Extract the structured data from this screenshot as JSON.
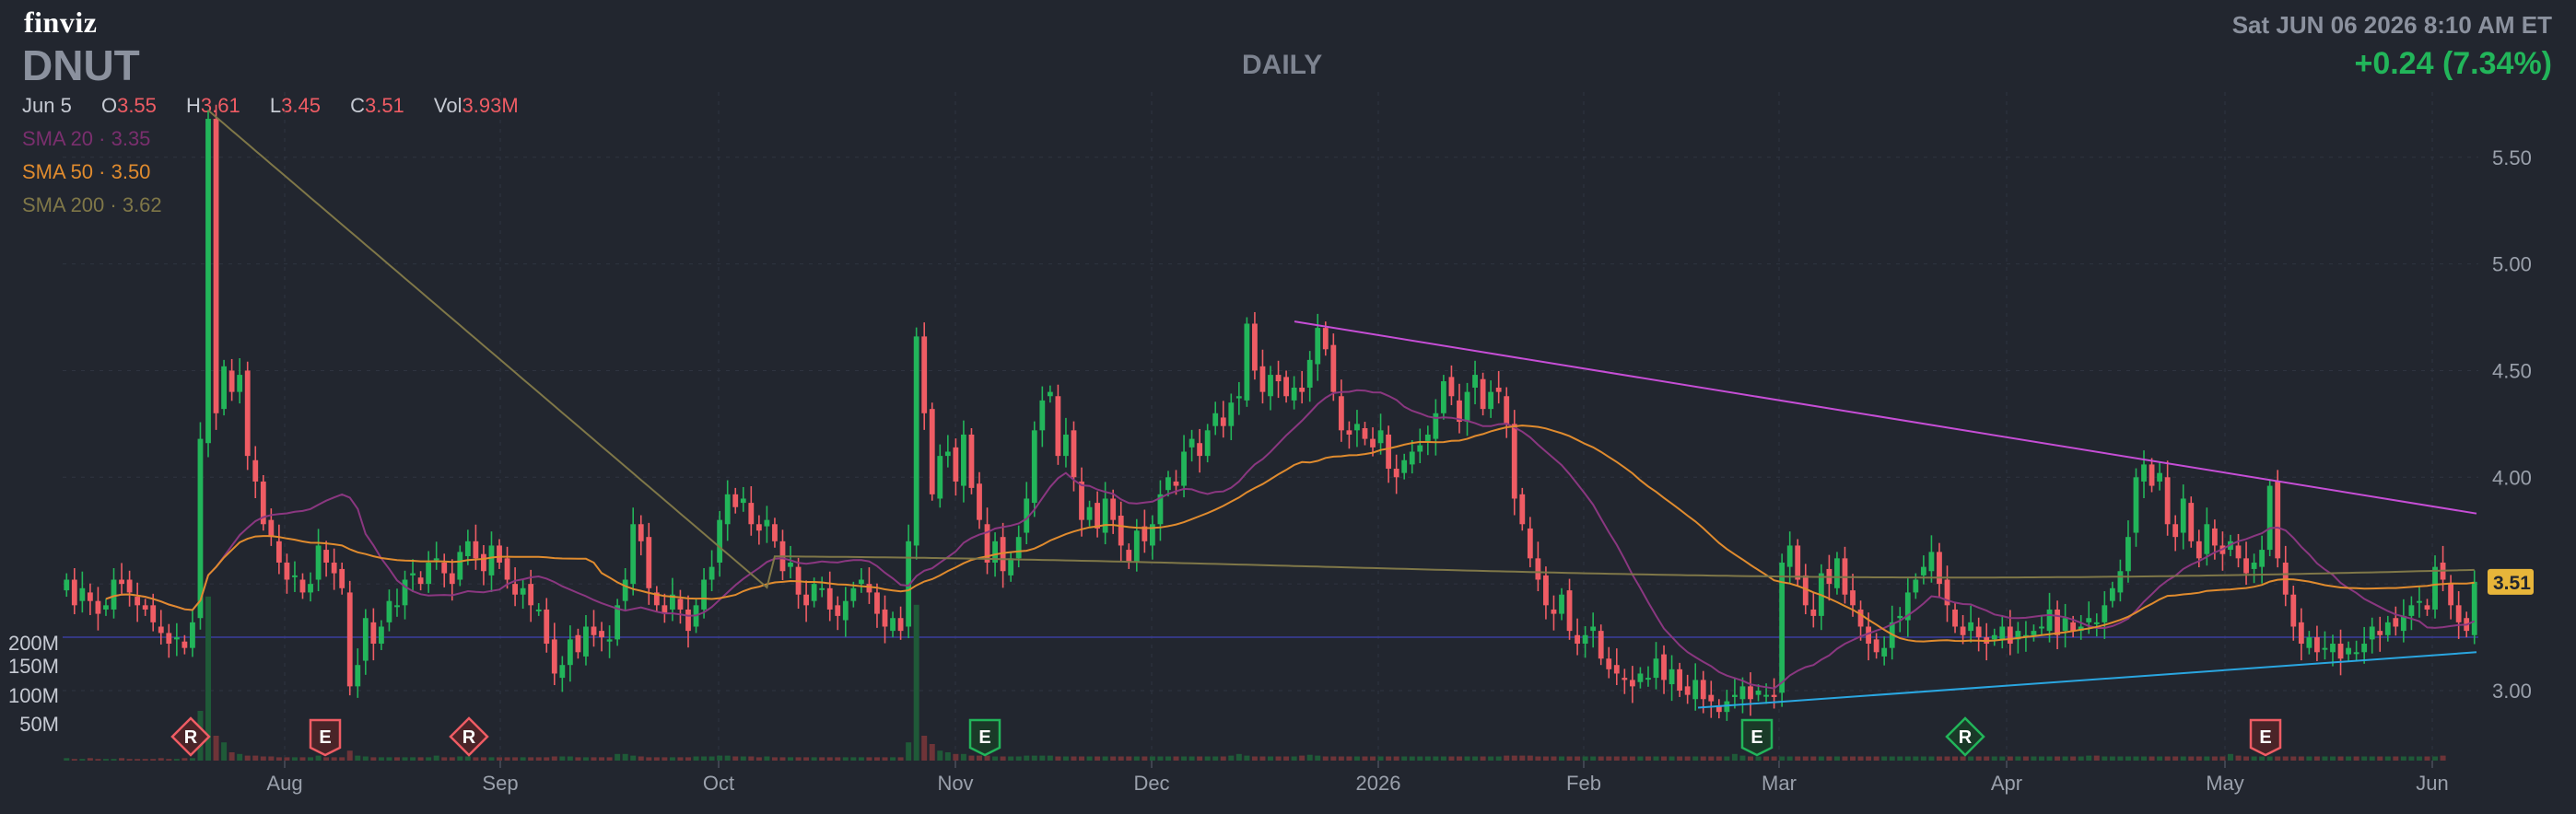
{
  "header": {
    "logo": "finviz",
    "ticker": "DNUT",
    "timeframe": "DAILY",
    "datetime": "Sat JUN 06 2026 8:10 AM ET",
    "change": "+0.24 (7.34%)"
  },
  "ohlc": {
    "date": "Jun 5",
    "o_label": "O",
    "o": "3.55",
    "h_label": "H",
    "h": "3.61",
    "l_label": "L",
    "l": "3.45",
    "c_label": "C",
    "c": "3.51",
    "vol_label": "Vol",
    "vol": "3.93M"
  },
  "sma": {
    "sma20": "SMA 20 · 3.35",
    "sma50": "SMA 50 · 3.50",
    "sma200": "SMA 200 · 3.62"
  },
  "colors": {
    "background": "#22262f",
    "up": "#22b55a",
    "down": "#ef5c64",
    "sma20": "#7a2f6e",
    "sma50": "#e08b2e",
    "sma200": "#7f7748",
    "resistance": "#c64ed6",
    "support": "#2aa6e0",
    "level": "#3b3f9e"
  },
  "chart_data": {
    "type": "candlestick",
    "title": "",
    "price_axis": {
      "ticks": [
        "3.00",
        "3.50",
        "4.00",
        "4.50",
        "5.00",
        "5.50"
      ],
      "ylim": [
        2.62,
        5.85
      ],
      "last_price": "3.51"
    },
    "volume_axis": {
      "ticks": [
        "50M",
        "100M",
        "150M",
        "200M"
      ]
    },
    "x_ticks": [
      "Aug",
      "Sep",
      "Oct",
      "Nov",
      "Dec",
      "2026",
      "Feb",
      "Mar",
      "Apr",
      "May",
      "Jun"
    ],
    "markers": [
      {
        "label": "R",
        "kind": "down",
        "date": "Jul 22"
      },
      {
        "label": "E",
        "kind": "down",
        "date": "Aug 5"
      },
      {
        "label": "R",
        "kind": "down",
        "date": "Aug 22"
      },
      {
        "label": "E",
        "kind": "up",
        "date": "Nov 6"
      },
      {
        "label": "E",
        "kind": "up",
        "date": "Feb 26"
      },
      {
        "label": "R",
        "kind": "up",
        "date": "Mar 30"
      },
      {
        "label": "E",
        "kind": "down",
        "date": "May 7"
      }
    ],
    "closes": [
      3.52,
      3.4,
      3.48,
      3.42,
      3.36,
      3.4,
      3.52,
      3.5,
      3.46,
      3.4,
      3.38,
      3.32,
      3.27,
      3.22,
      3.25,
      3.2,
      3.32,
      4.18,
      5.68,
      4.3,
      4.52,
      4.4,
      4.48,
      4.1,
      3.98,
      3.78,
      3.72,
      3.6,
      3.52,
      3.54,
      3.46,
      3.5,
      3.68,
      3.6,
      3.55,
      3.48,
      3.02,
      3.12,
      3.34,
      3.22,
      3.3,
      3.42,
      3.4,
      3.52,
      3.55,
      3.5,
      3.6,
      3.62,
      3.55,
      3.5,
      3.65,
      3.7,
      3.62,
      3.56,
      3.68,
      3.6,
      3.52,
      3.45,
      3.48,
      3.4,
      3.38,
      3.22,
      3.08,
      3.12,
      3.24,
      3.18,
      3.3,
      3.26,
      3.25,
      3.24,
      3.4,
      3.52,
      3.78,
      3.7,
      3.48,
      3.4,
      3.36,
      3.45,
      3.38,
      3.28,
      3.4,
      3.52,
      3.58,
      3.8,
      3.92,
      3.86,
      3.9,
      3.78,
      3.75,
      3.8,
      3.7,
      3.56,
      3.6,
      3.45,
      3.4,
      3.5,
      3.48,
      3.38,
      3.35,
      3.42,
      3.48,
      3.52,
      3.46,
      3.36,
      3.3,
      3.34,
      3.28,
      3.7,
      4.66,
      4.3,
      3.92,
      4.1,
      4.12,
      3.98,
      4.2,
      3.95,
      3.8,
      3.6,
      3.7,
      3.56,
      3.62,
      3.72,
      3.9,
      4.22,
      4.36,
      4.4,
      4.1,
      4.2,
      4.0,
      3.8,
      3.86,
      3.76,
      3.9,
      3.8,
      3.68,
      3.6,
      3.75,
      3.7,
      3.78,
      3.92,
      4.0,
      3.96,
      4.12,
      4.18,
      4.1,
      4.22,
      4.3,
      4.24,
      4.35,
      4.38,
      4.72,
      4.5,
      4.4,
      4.48,
      4.45,
      4.38,
      4.42,
      4.4,
      4.55,
      4.7,
      4.6,
      4.4,
      4.22,
      4.2,
      4.25,
      4.18,
      4.14,
      4.22,
      4.04,
      4.0,
      4.08,
      4.12,
      4.15,
      4.2,
      4.3,
      4.45,
      4.38,
      4.26,
      4.4,
      4.48,
      4.32,
      4.4,
      4.4,
      4.25,
      3.9,
      3.78,
      3.62,
      3.52,
      3.4,
      3.36,
      3.45,
      3.28,
      3.22,
      3.26,
      3.3,
      3.15,
      3.1,
      3.08,
      3.05,
      3.02,
      3.08,
      3.06,
      3.15,
      3.05,
      3.1,
      3.0,
      2.98,
      3.05,
      2.96,
      2.95,
      2.9,
      2.95,
      2.98,
      3.02,
      2.96,
      3.0,
      2.98,
      2.97,
      3.6,
      3.68,
      3.52,
      3.4,
      3.35,
      3.55,
      3.5,
      3.62,
      3.45,
      3.4,
      3.3,
      3.22,
      3.18,
      3.2,
      3.32,
      3.35,
      3.46,
      3.52,
      3.58,
      3.65,
      3.5,
      3.4,
      3.3,
      3.26,
      3.32,
      3.25,
      3.22,
      3.26,
      3.3,
      3.22,
      3.28,
      3.26,
      3.28,
      3.3,
      3.38,
      3.26,
      3.34,
      3.28,
      3.3,
      3.34,
      3.32,
      3.4,
      3.48,
      3.56,
      3.72,
      4.0,
      4.06,
      3.96,
      4.02,
      3.78,
      3.72,
      3.9,
      3.7,
      3.62,
      3.78,
      3.68,
      3.64,
      3.7,
      3.62,
      3.55,
      3.6,
      3.66,
      3.96,
      3.62,
      3.45,
      3.3,
      3.22,
      3.25,
      3.18,
      3.2,
      3.22,
      3.15,
      3.2,
      3.18,
      3.22,
      3.3,
      3.26,
      3.32,
      3.3,
      3.35,
      3.4,
      3.42,
      3.38,
      3.58,
      3.52,
      3.4,
      3.32,
      3.28,
      3.51
    ],
    "volumes": [
      3,
      2,
      2,
      3,
      2,
      2,
      2,
      3,
      2,
      2,
      2,
      2,
      3,
      2,
      2,
      3,
      3,
      60,
      198,
      30,
      22,
      10,
      8,
      6,
      6,
      5,
      5,
      4,
      4,
      4,
      4,
      4,
      6,
      4,
      4,
      4,
      12,
      6,
      5,
      4,
      4,
      4,
      4,
      4,
      4,
      4,
      4,
      6,
      4,
      4,
      5,
      5,
      4,
      4,
      4,
      4,
      4,
      4,
      4,
      4,
      4,
      4,
      5,
      5,
      5,
      4,
      4,
      4,
      4,
      4,
      8,
      8,
      6,
      5,
      4,
      4,
      4,
      4,
      4,
      4,
      5,
      5,
      5,
      6,
      6,
      5,
      5,
      5,
      4,
      5,
      4,
      4,
      4,
      4,
      4,
      4,
      4,
      4,
      4,
      4,
      4,
      4,
      4,
      4,
      4,
      4,
      4,
      22,
      188,
      30,
      20,
      12,
      10,
      8,
      8,
      6,
      6,
      6,
      5,
      5,
      5,
      5,
      6,
      6,
      6,
      6,
      5,
      5,
      5,
      5,
      5,
      5,
      5,
      5,
      5,
      5,
      5,
      5,
      5,
      5,
      5,
      5,
      5,
      5,
      5,
      5,
      5,
      5,
      6,
      8,
      6,
      5,
      5,
      5,
      5,
      5,
      5,
      6,
      7,
      6,
      5,
      5,
      5,
      5,
      5,
      5,
      5,
      5,
      5,
      5,
      5,
      5,
      5,
      5,
      5,
      5,
      5,
      5,
      5,
      5,
      5,
      5,
      5,
      6,
      6,
      6,
      6,
      5,
      5,
      5,
      5,
      5,
      5,
      5,
      5,
      5,
      5,
      5,
      5,
      5,
      5,
      5,
      5,
      5,
      5,
      5,
      5,
      5,
      5,
      5,
      5,
      5,
      8,
      6,
      5,
      5,
      5,
      5,
      5,
      5,
      5,
      5,
      5,
      5,
      5,
      5,
      5,
      5,
      5,
      5,
      5,
      5,
      5,
      5,
      5,
      5,
      5,
      5,
      5,
      5,
      5,
      5,
      5,
      5,
      5,
      5,
      5,
      5,
      5,
      5,
      5,
      5,
      5,
      5,
      5,
      5,
      5,
      6,
      6,
      5,
      5,
      5,
      5,
      5,
      5,
      5,
      5,
      5,
      5,
      5,
      5,
      5,
      5,
      5,
      5,
      8,
      6,
      5,
      5,
      5,
      5,
      5,
      5,
      5,
      5,
      5,
      5,
      5,
      5,
      5,
      5,
      5,
      5,
      5,
      5,
      5,
      5,
      5,
      5,
      5,
      5,
      5,
      6
    ]
  }
}
